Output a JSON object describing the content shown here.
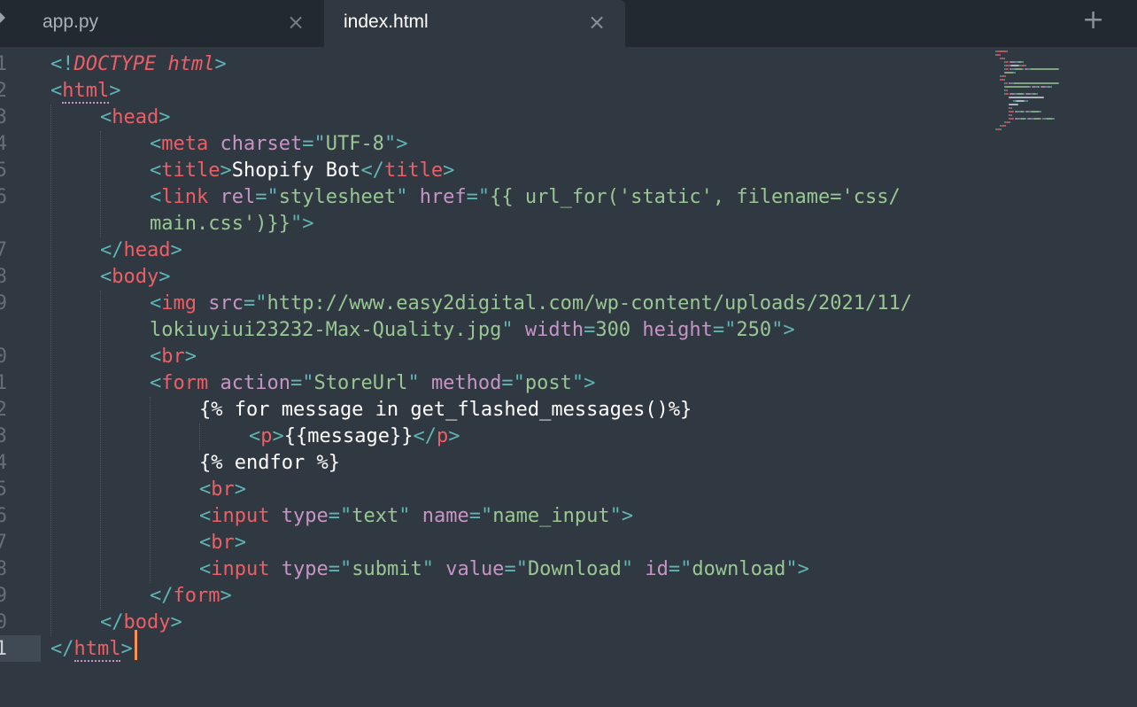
{
  "tabs": [
    {
      "label": "app.py",
      "active": false
    },
    {
      "label": "index.html",
      "active": true
    }
  ],
  "current_line": "21",
  "gutter": [
    "1",
    "2",
    "3",
    "4",
    "5",
    "6",
    "",
    "7",
    "8",
    "9",
    "",
    "0",
    "1",
    "2",
    "3",
    "4",
    "5",
    "6",
    "7",
    "8",
    "9",
    "0",
    "1"
  ],
  "lines": [
    {
      "indent": 0,
      "segments": [
        {
          "t": "<!",
          "c": "punct"
        },
        {
          "t": "DOCTYPE html",
          "c": "tag",
          "s": "italic"
        },
        {
          "t": ">",
          "c": "punct"
        }
      ]
    },
    {
      "indent": 0,
      "segments": [
        {
          "t": "<",
          "c": "punct"
        },
        {
          "t": "html",
          "c": "tag",
          "s": "under"
        },
        {
          "t": ">",
          "c": "punct"
        }
      ]
    },
    {
      "indent": 1,
      "segments": [
        {
          "t": "<",
          "c": "punct"
        },
        {
          "t": "head",
          "c": "tag"
        },
        {
          "t": ">",
          "c": "punct"
        }
      ]
    },
    {
      "indent": 2,
      "segments": [
        {
          "t": "<",
          "c": "punct"
        },
        {
          "t": "meta",
          "c": "tag"
        },
        {
          "t": " "
        },
        {
          "t": "charset",
          "c": "attr"
        },
        {
          "t": "=",
          "c": "punct"
        },
        {
          "t": "\"",
          "c": "punct"
        },
        {
          "t": "UTF-8",
          "c": "str"
        },
        {
          "t": "\"",
          "c": "punct"
        },
        {
          "t": ">",
          "c": "punct"
        }
      ]
    },
    {
      "indent": 2,
      "segments": [
        {
          "t": "<",
          "c": "punct"
        },
        {
          "t": "title",
          "c": "tag"
        },
        {
          "t": ">",
          "c": "punct"
        },
        {
          "t": "Shopify Bot",
          "c": "text"
        },
        {
          "t": "</",
          "c": "punct"
        },
        {
          "t": "title",
          "c": "tag"
        },
        {
          "t": ">",
          "c": "punct"
        }
      ]
    },
    {
      "indent": 2,
      "segments": [
        {
          "t": "<",
          "c": "punct"
        },
        {
          "t": "link",
          "c": "tag"
        },
        {
          "t": " "
        },
        {
          "t": "rel",
          "c": "attr"
        },
        {
          "t": "=",
          "c": "punct"
        },
        {
          "t": "\"",
          "c": "punct"
        },
        {
          "t": "stylesheet",
          "c": "str"
        },
        {
          "t": "\"",
          "c": "punct"
        },
        {
          "t": " "
        },
        {
          "t": "href",
          "c": "attr"
        },
        {
          "t": "=",
          "c": "punct"
        },
        {
          "t": "\"",
          "c": "punct"
        },
        {
          "t": "{{ url_for('static', filename='css/",
          "c": "str"
        }
      ]
    },
    {
      "indent": 2,
      "segments": [
        {
          "t": "main.css')}}",
          "c": "str"
        },
        {
          "t": "\"",
          "c": "punct"
        },
        {
          "t": ">",
          "c": "punct"
        }
      ]
    },
    {
      "indent": 1,
      "segments": [
        {
          "t": "</",
          "c": "punct"
        },
        {
          "t": "head",
          "c": "tag"
        },
        {
          "t": ">",
          "c": "punct"
        }
      ]
    },
    {
      "indent": 1,
      "segments": [
        {
          "t": "<",
          "c": "punct"
        },
        {
          "t": "body",
          "c": "tag"
        },
        {
          "t": ">",
          "c": "punct"
        }
      ]
    },
    {
      "indent": 2,
      "segments": [
        {
          "t": "<",
          "c": "punct"
        },
        {
          "t": "img",
          "c": "tag"
        },
        {
          "t": " "
        },
        {
          "t": "src",
          "c": "attr"
        },
        {
          "t": "=",
          "c": "punct"
        },
        {
          "t": "\"",
          "c": "punct"
        },
        {
          "t": "http://www.easy2digital.com/wp-content/uploads/2021/11/",
          "c": "str"
        }
      ]
    },
    {
      "indent": 2,
      "segments": [
        {
          "t": "lokiuyiui23232-Max-Quality.jpg",
          "c": "str"
        },
        {
          "t": "\"",
          "c": "punct"
        },
        {
          "t": " "
        },
        {
          "t": "width",
          "c": "attr"
        },
        {
          "t": "=",
          "c": "punct"
        },
        {
          "t": "300",
          "c": "str"
        },
        {
          "t": " "
        },
        {
          "t": "height",
          "c": "attr"
        },
        {
          "t": "=",
          "c": "punct"
        },
        {
          "t": "\"",
          "c": "punct"
        },
        {
          "t": "250",
          "c": "str"
        },
        {
          "t": "\"",
          "c": "punct"
        },
        {
          "t": ">",
          "c": "punct"
        }
      ]
    },
    {
      "indent": 2,
      "segments": [
        {
          "t": "<",
          "c": "punct"
        },
        {
          "t": "br",
          "c": "tag"
        },
        {
          "t": ">",
          "c": "punct"
        }
      ]
    },
    {
      "indent": 2,
      "segments": [
        {
          "t": "<",
          "c": "punct"
        },
        {
          "t": "form",
          "c": "tag"
        },
        {
          "t": " "
        },
        {
          "t": "action",
          "c": "attr"
        },
        {
          "t": "=",
          "c": "punct"
        },
        {
          "t": "\"",
          "c": "punct"
        },
        {
          "t": "StoreUrl",
          "c": "str"
        },
        {
          "t": "\"",
          "c": "punct"
        },
        {
          "t": " "
        },
        {
          "t": "method",
          "c": "attr"
        },
        {
          "t": "=",
          "c": "punct"
        },
        {
          "t": "\"",
          "c": "punct"
        },
        {
          "t": "post",
          "c": "str"
        },
        {
          "t": "\"",
          "c": "punct"
        },
        {
          "t": ">",
          "c": "punct"
        }
      ]
    },
    {
      "indent": 3,
      "segments": [
        {
          "t": "{% for message in get_flashed_messages()%}",
          "c": "text"
        }
      ]
    },
    {
      "indent": 4,
      "segments": [
        {
          "t": "<",
          "c": "punct"
        },
        {
          "t": "p",
          "c": "tag"
        },
        {
          "t": ">",
          "c": "punct"
        },
        {
          "t": "{{message}}",
          "c": "text"
        },
        {
          "t": "</",
          "c": "punct"
        },
        {
          "t": "p",
          "c": "tag"
        },
        {
          "t": ">",
          "c": "punct"
        }
      ]
    },
    {
      "indent": 3,
      "segments": [
        {
          "t": "{% endfor %}",
          "c": "text"
        }
      ]
    },
    {
      "indent": 3,
      "segments": [
        {
          "t": "<",
          "c": "punct"
        },
        {
          "t": "br",
          "c": "tag"
        },
        {
          "t": ">",
          "c": "punct"
        }
      ]
    },
    {
      "indent": 3,
      "segments": [
        {
          "t": "<",
          "c": "punct"
        },
        {
          "t": "input",
          "c": "tag"
        },
        {
          "t": " "
        },
        {
          "t": "type",
          "c": "attr"
        },
        {
          "t": "=",
          "c": "punct"
        },
        {
          "t": "\"",
          "c": "punct"
        },
        {
          "t": "text",
          "c": "str"
        },
        {
          "t": "\"",
          "c": "punct"
        },
        {
          "t": " "
        },
        {
          "t": "name",
          "c": "attr"
        },
        {
          "t": "=",
          "c": "punct"
        },
        {
          "t": "\"",
          "c": "punct"
        },
        {
          "t": "name_input",
          "c": "str"
        },
        {
          "t": "\"",
          "c": "punct"
        },
        {
          "t": ">",
          "c": "punct"
        }
      ]
    },
    {
      "indent": 3,
      "segments": [
        {
          "t": "<",
          "c": "punct"
        },
        {
          "t": "br",
          "c": "tag"
        },
        {
          "t": ">",
          "c": "punct"
        }
      ]
    },
    {
      "indent": 3,
      "segments": [
        {
          "t": "<",
          "c": "punct"
        },
        {
          "t": "input",
          "c": "tag"
        },
        {
          "t": " "
        },
        {
          "t": "type",
          "c": "attr"
        },
        {
          "t": "=",
          "c": "punct"
        },
        {
          "t": "\"",
          "c": "punct"
        },
        {
          "t": "submit",
          "c": "str"
        },
        {
          "t": "\"",
          "c": "punct"
        },
        {
          "t": " "
        },
        {
          "t": "value",
          "c": "attr"
        },
        {
          "t": "=",
          "c": "punct"
        },
        {
          "t": "\"",
          "c": "punct"
        },
        {
          "t": "Download",
          "c": "str"
        },
        {
          "t": "\"",
          "c": "punct"
        },
        {
          "t": " "
        },
        {
          "t": "id",
          "c": "attr"
        },
        {
          "t": "=",
          "c": "punct"
        },
        {
          "t": "\"",
          "c": "punct"
        },
        {
          "t": "download",
          "c": "str"
        },
        {
          "t": "\"",
          "c": "punct"
        },
        {
          "t": ">",
          "c": "punct"
        }
      ]
    },
    {
      "indent": 2,
      "segments": [
        {
          "t": "</",
          "c": "punct"
        },
        {
          "t": "form",
          "c": "tag"
        },
        {
          "t": ">",
          "c": "punct"
        }
      ]
    },
    {
      "indent": 1,
      "segments": [
        {
          "t": "</",
          "c": "punct"
        },
        {
          "t": "body",
          "c": "tag"
        },
        {
          "t": ">",
          "c": "punct"
        }
      ]
    },
    {
      "indent": 0,
      "segments": [
        {
          "t": "</",
          "c": "punct"
        },
        {
          "t": "html",
          "c": "tag",
          "s": "under"
        },
        {
          "t": ">",
          "c": "punct"
        }
      ]
    }
  ],
  "colors": {
    "background": "#303841",
    "tabbar": "#222930",
    "tag": "#ec5f66",
    "attribute": "#c695c6",
    "string": "#99c794",
    "punctuation": "#5fb4b4",
    "text": "#ffffff",
    "caret": "#f99157"
  }
}
